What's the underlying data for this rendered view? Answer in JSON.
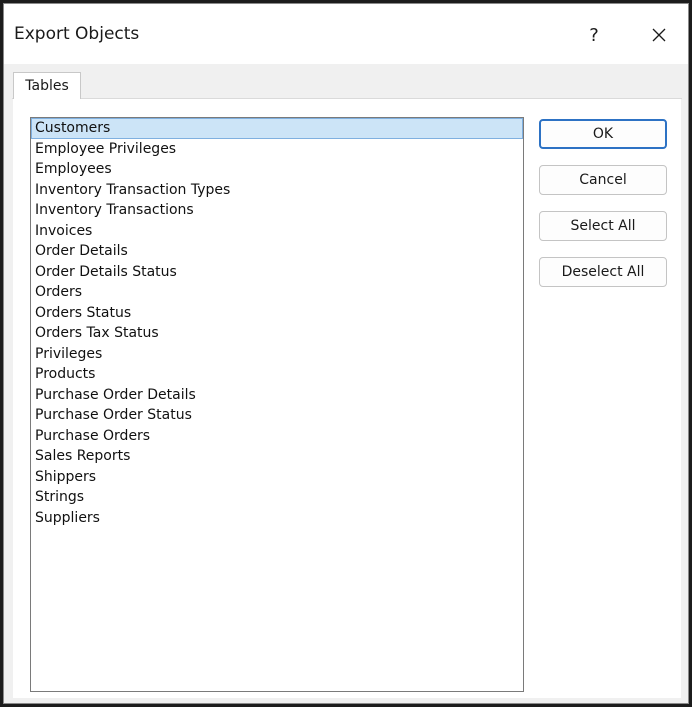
{
  "dialog": {
    "title": "Export Objects",
    "help_label": "?",
    "close_icon": "close-icon"
  },
  "tabs": [
    {
      "label": "Tables",
      "active": true
    }
  ],
  "list": {
    "selected_index": 0,
    "items": [
      "Customers",
      "Employee Privileges",
      "Employees",
      "Inventory Transaction Types",
      "Inventory Transactions",
      "Invoices",
      "Order Details",
      "Order Details Status",
      "Orders",
      "Orders Status",
      "Orders Tax Status",
      "Privileges",
      "Products",
      "Purchase Order Details",
      "Purchase Order Status",
      "Purchase Orders",
      "Sales Reports",
      "Shippers",
      "Strings",
      "Suppliers"
    ]
  },
  "buttons": {
    "ok": "OK",
    "cancel": "Cancel",
    "select_all": "Select All",
    "deselect_all": "Deselect All"
  },
  "colors": {
    "selection_bg": "#cce4f7",
    "default_button_border": "#2d72c4"
  }
}
